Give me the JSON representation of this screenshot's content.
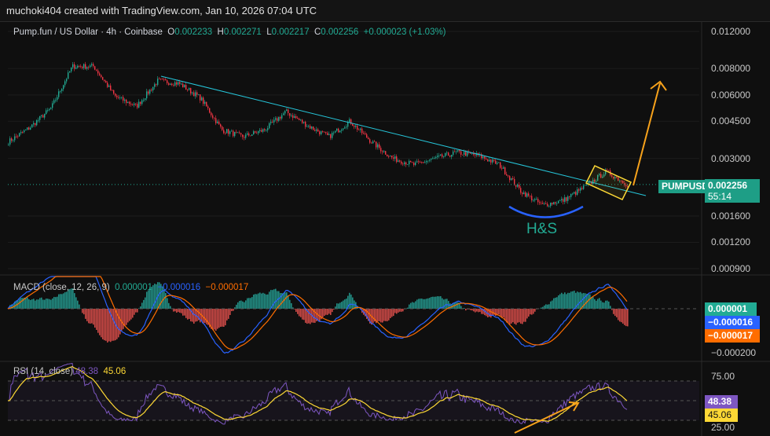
{
  "header": {
    "attribution": "muchoki404 created with TradingView.com, Jan 10, 2026 07:04 UTC"
  },
  "legend": {
    "symbol": "Pump.fun / US Dollar · 4h · Coinbase",
    "o_label": "O",
    "o": "0.002233",
    "h_label": "H",
    "h": "0.002271",
    "l_label": "L",
    "l": "0.002217",
    "c_label": "C",
    "c": "0.002256",
    "change": "+0.000023 (+1.03%)"
  },
  "price_axis": [
    "0.012000",
    "0.008000",
    "0.006000",
    "0.004500",
    "0.003000",
    "0.001600",
    "0.001200",
    "0.000900"
  ],
  "last_price": {
    "symbol": "PUMPUSD",
    "price": "0.002256",
    "countdown": "55:14"
  },
  "annotation": {
    "pattern": "H&S"
  },
  "macd": {
    "title": "MACD (close, 12, 26, 9)",
    "hist": "0.000001",
    "macd": "−0.000016",
    "signal": "−0.000017",
    "axis": "−0.000200"
  },
  "rsi": {
    "title": "RSI (14, close)",
    "rsi": "48.38",
    "ma": "45.06",
    "axis": [
      "75.00",
      "25.00"
    ]
  },
  "colors": {
    "up": "#22ab94",
    "down": "#f23645",
    "macd": "#2962ff",
    "signal": "#ff6d00",
    "rsi": "#7e57c2",
    "rsi_ma": "#fdd835",
    "trend": "#26c6da",
    "arrow": "#f7a21b"
  },
  "chart_data": {
    "type": "candlestick",
    "title": "Pump.fun / US Dollar · 4h · Coinbase",
    "yscale": "log",
    "ylim": [
      0.00085,
      0.0125
    ],
    "approx_close_path": [
      0.0036,
      0.0042,
      0.0052,
      0.0082,
      0.0082,
      0.0059,
      0.0053,
      0.007,
      0.0068,
      0.0058,
      0.0041,
      0.0038,
      0.0041,
      0.005,
      0.0043,
      0.0038,
      0.0045,
      0.0036,
      0.003,
      0.0028,
      0.003,
      0.0032,
      0.0031,
      0.0028,
      0.0021,
      0.0018,
      0.0019,
      0.0022,
      0.0026,
      0.002256
    ]
  }
}
